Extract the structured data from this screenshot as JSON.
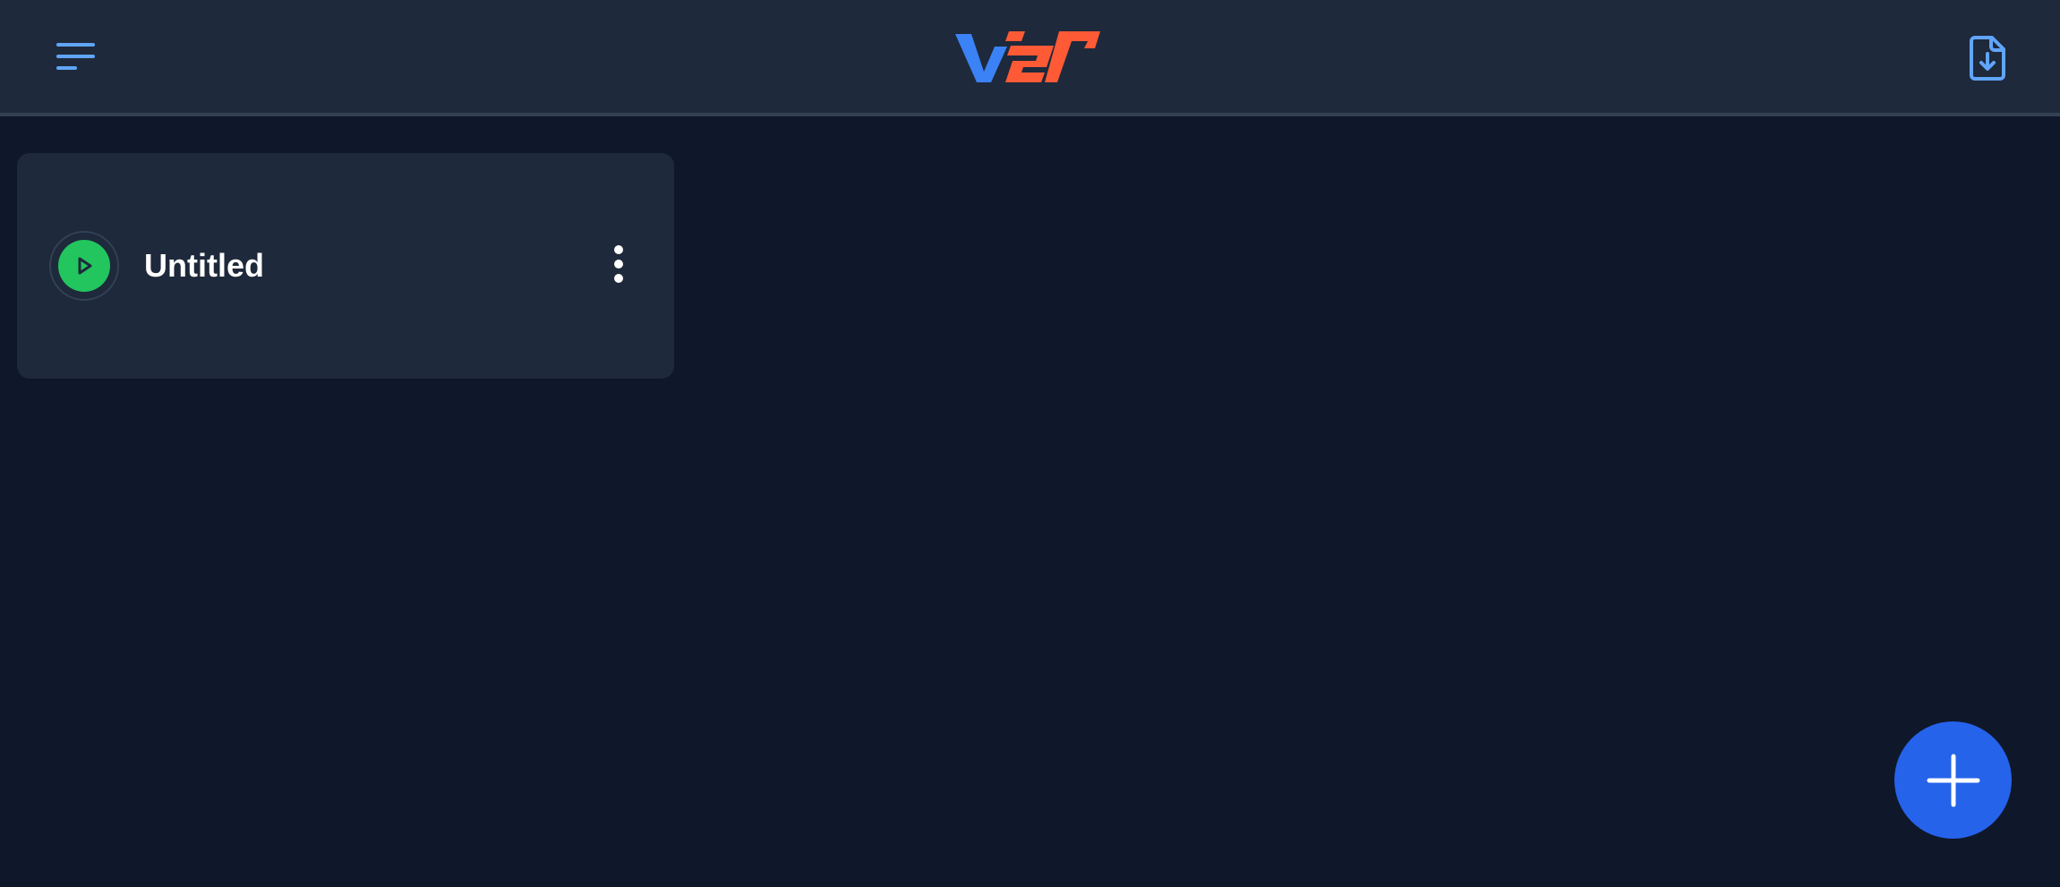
{
  "header": {
    "menu_icon": "hamburger-menu-icon",
    "logo": {
      "text": "V2r",
      "color_primary": "#3b82f6",
      "color_accent": "#ff5a36"
    },
    "import_icon": "file-download-icon"
  },
  "projects": [
    {
      "title": "Untitled",
      "status_icon": "play-icon",
      "status_color": "#22c55e",
      "menu_icon": "more-vertical-icon"
    }
  ],
  "fab": {
    "icon": "plus-icon",
    "color": "#2563eb"
  },
  "colors": {
    "background": "#0f172a",
    "surface": "#1e293b",
    "accent": "#60a5fa"
  }
}
